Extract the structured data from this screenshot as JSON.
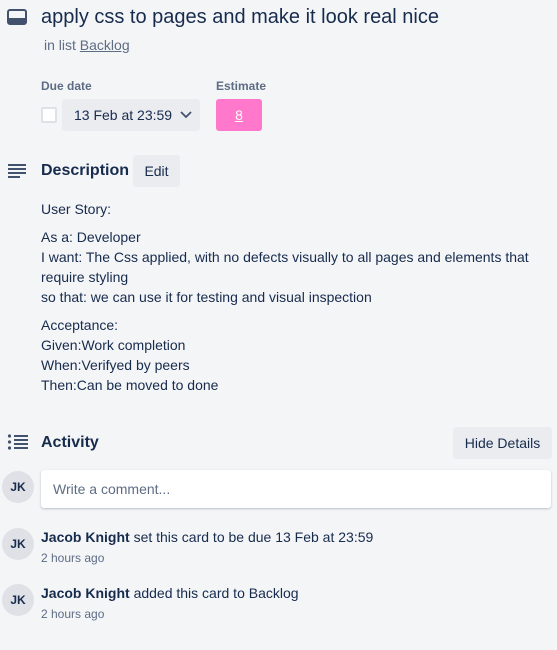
{
  "card": {
    "title": "apply css to pages and make it look real nice",
    "in_list_prefix": "in list",
    "list_name": "Backlog"
  },
  "fields": {
    "due_label": "Due date",
    "due_value": "13 Feb at 23:59",
    "estimate_label": "Estimate",
    "estimate_value": "8",
    "estimate_color": "#ff78cb"
  },
  "description": {
    "heading": "Description",
    "edit_label": "Edit",
    "paragraphs": [
      [
        "User Story:"
      ],
      [
        "As a: Developer",
        "I want: The Css applied, with no defects visually to all pages and elements that require styling",
        "so that: we can use it for testing and visual inspection"
      ],
      [
        "Acceptance:",
        "Given:Work completion",
        "When:Verifyed by peers",
        "Then:Can be moved to done"
      ]
    ]
  },
  "activity": {
    "heading": "Activity",
    "toggle_label": "Hide Details",
    "comment_placeholder": "Write a comment...",
    "user_initials": "JK",
    "entries": [
      {
        "initials": "JK",
        "user": "Jacob Knight",
        "action": "set this card to be due 13 Feb at 23:59",
        "time": "2 hours ago"
      },
      {
        "initials": "JK",
        "user": "Jacob Knight",
        "action": "added this card to Backlog",
        "time": "2 hours ago"
      }
    ]
  },
  "icons": {
    "card": "card-icon",
    "description": "description-icon",
    "activity": "activity-icon",
    "chevron": "chevron-down-icon"
  }
}
